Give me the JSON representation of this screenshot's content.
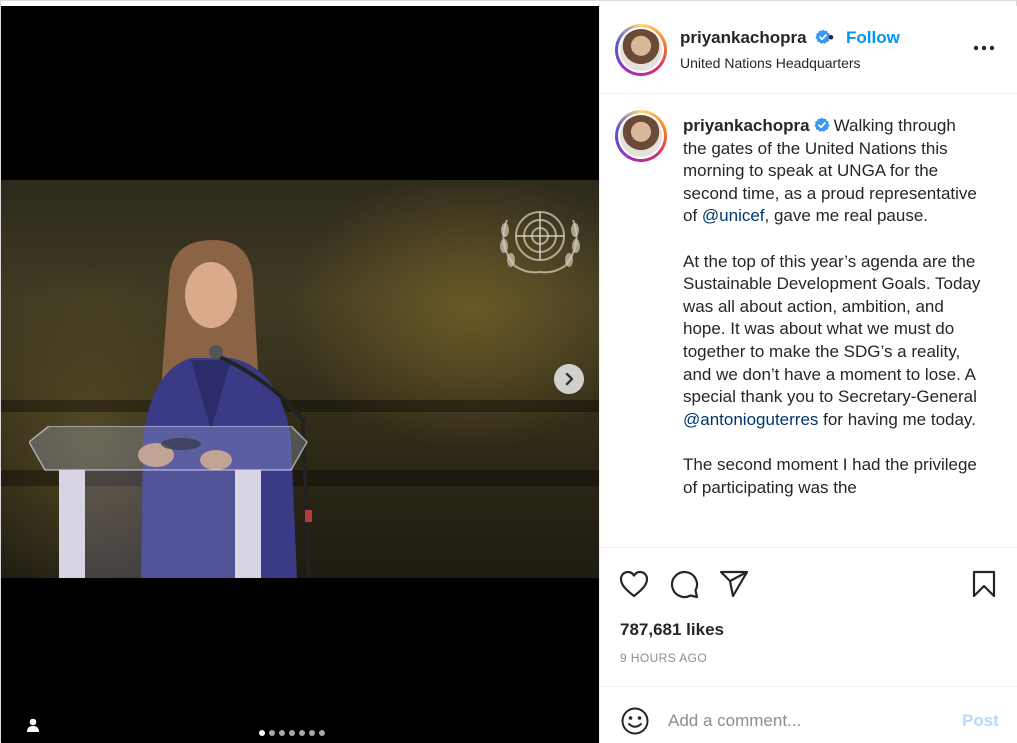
{
  "post": {
    "username": "priyankachopra",
    "follow_label": "Follow",
    "separator": "•",
    "location": "United Nations Headquarters",
    "verified": true
  },
  "media": {
    "slide_count": 7,
    "active_slide": 1,
    "next_icon": "chevron-right-icon",
    "user_tag_icon": "user-tag-icon"
  },
  "caption": {
    "username": "priyankachopra",
    "p1_a": "Walking through the gates of the United Nations this morning to speak at UNGA for the second time, as a proud representative of ",
    "p1_mention": "@unicef",
    "p1_b": ", gave me real pause.",
    "p2_a": "At the top of this year’s agenda are the Sustainable Development Goals. Today was all about action, ambition, and hope. It was about what we must do together to make the SDG’s a reality, and we don’t have a moment to lose. A special thank you to Secretary-General ",
    "p2_mention": "@antonioguterres",
    "p2_b": " for having me today.",
    "p3": "The second moment I had the privilege of participating was the"
  },
  "actions": {
    "like_icon": "heart-icon",
    "comment_icon": "comment-icon",
    "share_icon": "send-icon",
    "save_icon": "bookmark-icon",
    "likes": "787,681 likes",
    "timestamp": "9 HOURS AGO"
  },
  "comment": {
    "placeholder": "Add a comment...",
    "post_label": "Post"
  },
  "colors": {
    "accent": "#0095f6",
    "mention": "#00376b",
    "post_disabled": "#b3dbff"
  }
}
